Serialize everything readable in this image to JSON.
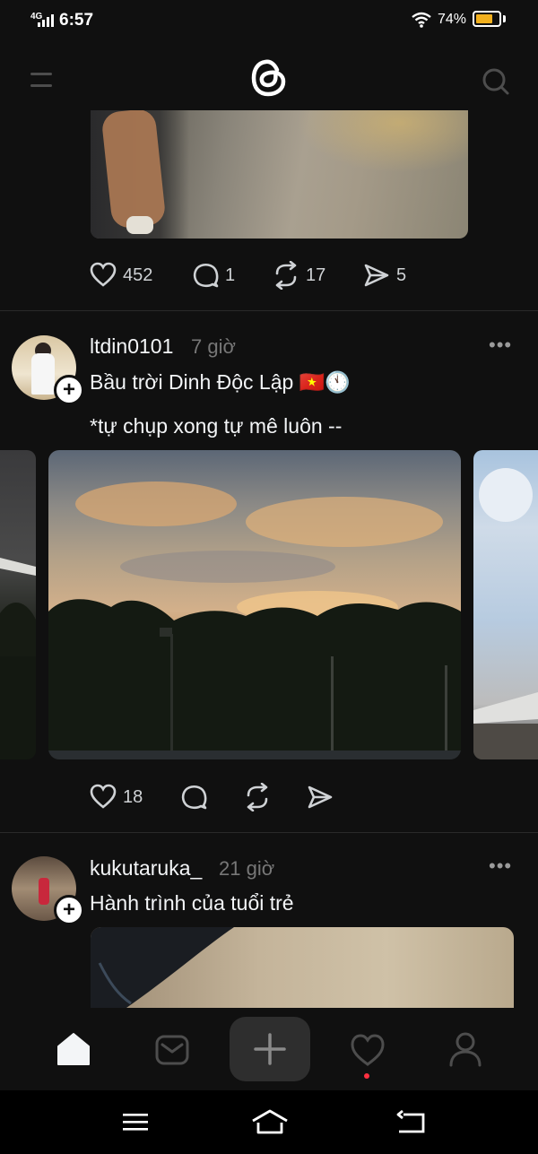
{
  "status_bar": {
    "network": "4G",
    "time": "6:57",
    "battery_percent": "74%",
    "battery_level": 0.74
  },
  "header": {
    "menu_icon": "menu-icon",
    "logo_icon": "threads-logo-icon",
    "search_icon": "search-icon"
  },
  "posts": [
    {
      "likes": "452",
      "replies": "1",
      "reposts": "17",
      "shares": "5"
    },
    {
      "username": "ltdin0101",
      "time": "7 giờ",
      "caption_line1": "Bầu trời Dinh Độc Lập 🇻🇳🕚",
      "caption_line2": "*tự chụp xong tự mê luôn --",
      "likes": "18"
    },
    {
      "username": "kukutaruka_",
      "time": "21 giờ",
      "caption": "Hành trình của tuổi trẻ"
    }
  ],
  "more_label": "•••",
  "bottom_nav": {
    "items": [
      "home-icon",
      "inbox-icon",
      "new-thread-icon",
      "activity-icon",
      "profile-icon"
    ],
    "active": "home-icon",
    "activity_dot_color": "#ff3040"
  },
  "colors": {
    "background": "#101010",
    "battery": "#f2b01e"
  }
}
